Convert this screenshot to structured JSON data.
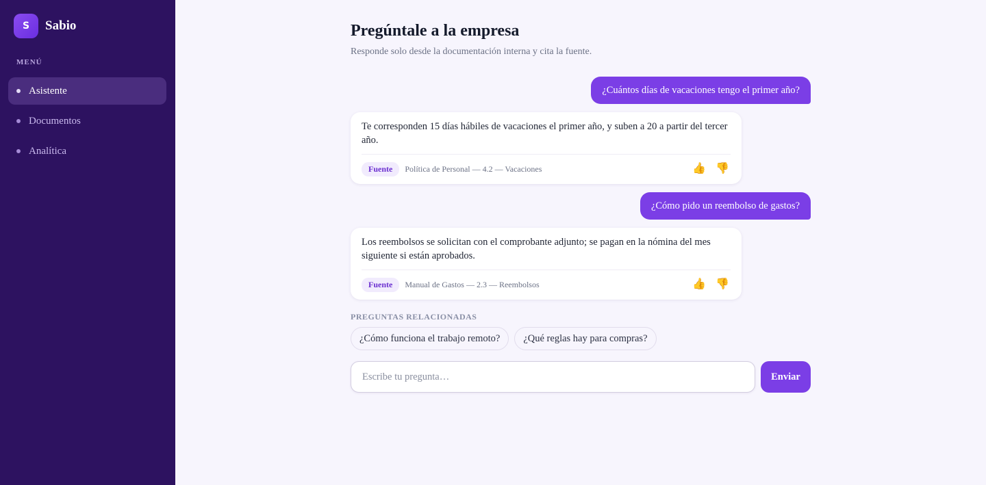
{
  "brand": {
    "logo_letter": "S",
    "name": "Sabio"
  },
  "sidebar": {
    "menu_label": "MENÚ",
    "items": [
      {
        "label": "Asistente",
        "active": true
      },
      {
        "label": "Documentos",
        "active": false
      },
      {
        "label": "Analítica",
        "active": false
      }
    ]
  },
  "header": {
    "title": "Pregúntale a la empresa",
    "subtitle": "Responde solo desde la documentación interna y cita la fuente."
  },
  "conversation": [
    {
      "role": "user",
      "text": "¿Cuántos días de vacaciones tengo el primer año?"
    },
    {
      "role": "assistant",
      "text": "Te corresponden 15 días hábiles de vacaciones el primer año, y suben a 20 a partir del tercer año.",
      "source_label": "Fuente",
      "source": "Política de Personal — 4.2 — Vacaciones"
    },
    {
      "role": "user",
      "text": "¿Cómo pido un reembolso de gastos?"
    },
    {
      "role": "assistant",
      "text": "Los reembolsos se solicitan con el comprobante adjunto; se pagan en la nómina del mes siguiente si están aprobados.",
      "source_label": "Fuente",
      "source": "Manual de Gastos — 2.3 — Reembolsos"
    }
  ],
  "feedback": {
    "up_icon": "👍",
    "down_icon": "👎"
  },
  "related": {
    "label": "PREGUNTAS RELACIONADAS",
    "questions": [
      "¿Cómo funciona el trabajo remoto?",
      "¿Qué reglas hay para compras?"
    ]
  },
  "composer": {
    "placeholder": "Escribe tu pregunta…",
    "value": "",
    "send_label": "Enviar"
  },
  "colors": {
    "sidebar_bg": "#2d1260",
    "accent": "#7b3ee6",
    "page_bg": "#f7f5fd"
  }
}
